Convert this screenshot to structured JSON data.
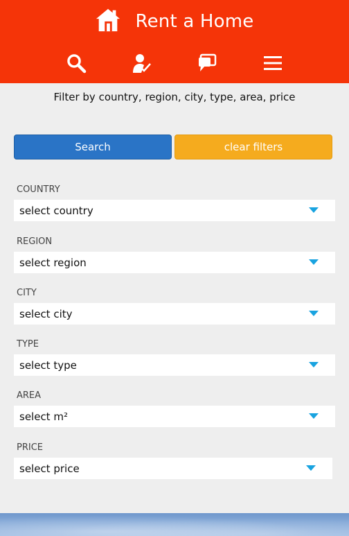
{
  "app": {
    "title": "Rent a Home"
  },
  "nav": {
    "icons": [
      "search-icon",
      "user-check-icon",
      "chat-icon",
      "menu-icon"
    ]
  },
  "subtitle": "Filter by country, region, city, type, area, price",
  "actions": {
    "search_label": "Search",
    "clear_label": "clear filters"
  },
  "filters": [
    {
      "label": "COUNTRY",
      "placeholder": "select country"
    },
    {
      "label": "REGION",
      "placeholder": "select region"
    },
    {
      "label": "CITY",
      "placeholder": "select city"
    },
    {
      "label": "TYPE",
      "placeholder": "select type"
    },
    {
      "label": "AREA",
      "placeholder": "select m²"
    },
    {
      "label": "PRICE",
      "placeholder": "select price"
    }
  ],
  "colors": {
    "header": "#f53408",
    "search_button": "#2a74c6",
    "clear_button": "#f5ab1e",
    "caret": "#19a3e0",
    "background": "#eeeeee"
  }
}
